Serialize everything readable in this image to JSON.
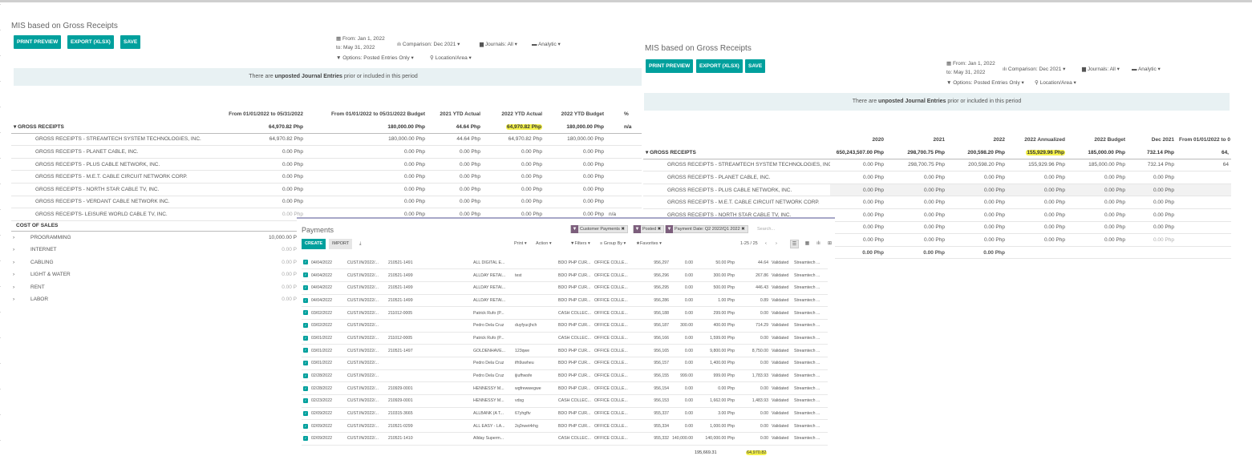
{
  "colors": {
    "accent": "#00a09d",
    "highlight": "#f5f24a",
    "banner": "#e8f1f3",
    "facet": "#7c5e7c"
  },
  "left_report": {
    "title": "MIS based on Gross Receipts",
    "buttons": {
      "print_preview": "PRINT PREVIEW",
      "export": "EXPORT (XLSX)",
      "save": "SAVE"
    },
    "filters": {
      "from": "From: Jan 1, 2022",
      "to": "to: May 31, 2022",
      "comparison": "Comparison: Dec 2021",
      "journals": "Journals: All",
      "analytic": "Analytic",
      "options": "Options: Posted Entries Only",
      "location": "Location/Area"
    },
    "banner": {
      "prefix": "There are ",
      "bold": "unposted Journal Entries",
      "suffix": " prior or included in this period"
    },
    "columns": [
      "From 01/01/2022 to 05/31/2022",
      "From 01/01/2022 to 05/31/2022 Budget",
      "2021 YTD Actual",
      "2022 YTD Actual",
      "2022 YTD Budget",
      "%"
    ],
    "group": {
      "label": "GROSS RECEIPTS",
      "values": [
        "64,970.82 Php",
        "180,000.00 Php",
        "44.64 Php",
        "64,970.82 Php",
        "180,000.00 Php",
        "n/a"
      ]
    },
    "rows": [
      {
        "label": "GROSS RECEIPTS - STREAMTECH SYSTEM TECHNOLOGIES, INC.",
        "values": [
          "64,970.82 Php",
          "180,000.00 Php",
          "44.64 Php",
          "64,970.82 Php",
          "180,000.00 Php",
          ""
        ]
      },
      {
        "label": "GROSS RECEIPTS - PLANET CABLE, INC.",
        "values": [
          "0.00 Php",
          "0.00 Php",
          "0.00 Php",
          "0.00 Php",
          "0.00 Php",
          ""
        ]
      },
      {
        "label": "GROSS RECEIPTS - PLUS CABLE NETWORK, INC.",
        "values": [
          "0.00 Php",
          "0.00 Php",
          "0.00 Php",
          "0.00 Php",
          "0.00 Php",
          ""
        ]
      },
      {
        "label": "GROSS RECEIPTS - M.E.T. CABLE CIRCUIT NETWORK CORP.",
        "values": [
          "0.00 Php",
          "0.00 Php",
          "0.00 Php",
          "0.00 Php",
          "0.00 Php",
          ""
        ]
      },
      {
        "label": "GROSS RECEIPTS - NORTH STAR CABLE TV, INC.",
        "values": [
          "0.00 Php",
          "0.00 Php",
          "0.00 Php",
          "0.00 Php",
          "0.00 Php",
          ""
        ]
      },
      {
        "label": "GROSS RECEIPTS - VERDANT CABLE NETWORK INC.",
        "values": [
          "0.00 Php",
          "0.00 Php",
          "0.00 Php",
          "0.00 Php",
          "0.00 Php",
          ""
        ]
      },
      {
        "label": "GROSS RECEIPTS- LEISURE WORLD CABLE TV, INC.",
        "values": [
          "0.00 Php",
          "0.00 Php",
          "0.00 Php",
          "0.00 Php",
          "0.00 Php",
          "n/a"
        ]
      }
    ],
    "cost_of_sales": {
      "label": "COST OF SALES",
      "items": [
        {
          "label": "PROGRAMMING",
          "value": "10,000.00 P"
        },
        {
          "label": "INTERNET",
          "value": "0.00 P"
        },
        {
          "label": "CABLING",
          "value": "0.00 P"
        },
        {
          "label": "LIGHT & WATER",
          "value": "0.00 P"
        },
        {
          "label": "RENT",
          "value": "0.00 P"
        },
        {
          "label": "LABOR",
          "value": "0.00 P"
        }
      ]
    }
  },
  "right_report": {
    "title": "MIS based on Gross Receipts",
    "buttons": {
      "print_preview": "PRINT PREVIEW",
      "export": "EXPORT (XLSX)",
      "save": "SAVE"
    },
    "filters": {
      "from": "From: Jan 1, 2022",
      "to": "to: May 31, 2022",
      "comparison": "Comparison: Dec 2021",
      "journals": "Journals: All",
      "analytic": "Analytic",
      "options": "Options: Posted Entries Only",
      "location": "Location/Area"
    },
    "banner": {
      "prefix": "There are ",
      "bold": "unposted Journal Entries",
      "suffix": " prior or included in this period"
    },
    "columns": [
      "2020",
      "2021",
      "2022",
      "2022 Annualized",
      "2022 Budget",
      "Dec 2021",
      "From 01/01/2022 to 0"
    ],
    "group": {
      "label": "GROSS RECEIPTS",
      "values": [
        "650,243,507.00 Php",
        "298,700.75 Php",
        "200,598.20 Php",
        "155,929.96 Php",
        "185,000.00 Php",
        "732.14 Php",
        "64,"
      ]
    },
    "rows": [
      {
        "label": "GROSS RECEIPTS - STREAMTECH SYSTEM TECHNOLOGIES, INC.",
        "values": [
          "0.00 Php",
          "298,700.75 Php",
          "200,598.20 Php",
          "155,929.96 Php",
          "185,000.00 Php",
          "732.14 Php",
          "64"
        ]
      },
      {
        "label": "GROSS RECEIPTS - PLANET CABLE, INC.",
        "values": [
          "0.00 Php",
          "0.00 Php",
          "0.00 Php",
          "0.00 Php",
          "0.00 Php",
          "0.00 Php",
          ""
        ]
      },
      {
        "label": "GROSS RECEIPTS - PLUS CABLE NETWORK, INC.",
        "values": [
          "0.00 Php",
          "0.00 Php",
          "0.00 Php",
          "0.00 Php",
          "0.00 Php",
          "0.00 Php",
          ""
        ]
      },
      {
        "label": "GROSS RECEIPTS - M.E.T. CABLE CIRCUIT NETWORK CORP.",
        "values": [
          "0.00 Php",
          "0.00 Php",
          "0.00 Php",
          "0.00 Php",
          "0.00 Php",
          "0.00 Php",
          ""
        ]
      },
      {
        "label": "GROSS RECEIPTS - NORTH STAR CABLE TV, INC.",
        "values": [
          "0.00 Php",
          "0.00 Php",
          "0.00 Php",
          "0.00 Php",
          "0.00 Php",
          "0.00 Php",
          ""
        ]
      },
      {
        "label": "",
        "values": [
          "0.00 Php",
          "0.00 Php",
          "0.00 Php",
          "0.00 Php",
          "0.00 Php",
          "0.00 Php",
          ""
        ]
      },
      {
        "label": "",
        "values": [
          "0.00 Php",
          "0.00 Php",
          "0.00 Php",
          "0.00 Php",
          "0.00 Php",
          "0.00 Php",
          ""
        ]
      },
      {
        "label": "",
        "values": [
          "0.00 Php",
          "0.00 Php",
          "0.00 Php",
          "",
          "",
          "",
          ""
        ]
      }
    ]
  },
  "payments": {
    "title": "Payments",
    "facets": [
      "Customer Payments",
      "Posted",
      "Payment Date: Q2 2022/Q1 2022"
    ],
    "search_placeholder": "Search...",
    "create": "CREATE",
    "import": "IMPORT",
    "print": "Print",
    "action": "Action",
    "filters": "Filters",
    "group_by": "Group By",
    "favorites": "Favorites",
    "pager": "1-25 / 25",
    "rows": [
      [
        "04/04/2022",
        "CUST.IN/2022/...",
        "210521-1491",
        "ALL DIGITAL E...",
        "",
        "BDO PHP CUR...",
        "OFFICE COLLE...",
        "956,297",
        "0.00",
        "50.00 Php",
        "44.64",
        "Validated",
        "Streamtech ..."
      ],
      [
        "04/04/2022",
        "CUST.IN/2022/...",
        "210521-1499",
        "ALLDAY RETAI...",
        "test",
        "BDO PHP CUR...",
        "OFFICE COLLE...",
        "956,296",
        "0.00",
        "300.00 Php",
        "267.86",
        "Validated",
        "Streamtech ..."
      ],
      [
        "04/04/2022",
        "CUST.IN/2022/...",
        "210521-1499",
        "ALLDAY RETAI...",
        "",
        "BDO PHP CUR...",
        "OFFICE COLLE...",
        "956,295",
        "0.00",
        "500.00 Php",
        "446.43",
        "Validated",
        "Streamtech ..."
      ],
      [
        "04/04/2022",
        "CUST.IN/2022/...",
        "210521-1499",
        "ALLDAY RETAI...",
        "",
        "BDO PHP CUR...",
        "OFFICE COLLE...",
        "956,286",
        "0.00",
        "1.00 Php",
        "0.89",
        "Validated",
        "Streamtech ..."
      ],
      [
        "03/02/2022",
        "CUST.IN/2022/...",
        "211012-0005",
        "Patrick Rufo (P...",
        "",
        "CASH COLLEC...",
        "OFFICE COLLE...",
        "956,188",
        "0.00",
        "299.00 Php",
        "0.00",
        "Validated",
        "Streamtech ..."
      ],
      [
        "03/02/2022",
        "CUST.IN/2022/...",
        "",
        "Pedro Dela Cruz",
        "duyfyucjhch",
        "BDO PHP CUR...",
        "OFFICE COLLE...",
        "956,187",
        "300.00",
        "400.00 Php",
        "714.29",
        "Validated",
        "Streamtech ..."
      ],
      [
        "03/01/2022",
        "CUST.IN/2022/...",
        "211012-0005",
        "Patrick Rufo (P...",
        "",
        "CASH COLLEC...",
        "OFFICE COLLE...",
        "956,166",
        "0.00",
        "1,599.00 Php",
        "0.00",
        "Validated",
        "Streamtech ..."
      ],
      [
        "03/01/2022",
        "CUST.IN/2022/...",
        "210521-1497",
        "GOLDENHAVE...",
        "123qwe",
        "BDO PHP CUR...",
        "OFFICE COLLE...",
        "956,165",
        "0.00",
        "9,800.00 Php",
        "8,750.00",
        "Validated",
        "Streamtech ..."
      ],
      [
        "03/01/2022",
        "CUST.IN/2022/...",
        "",
        "Pedro Dela Cruz",
        "ifh9uwheu",
        "BDO PHP CUR...",
        "OFFICE COLLE...",
        "956,157",
        "0.00",
        "1,400.00 Php",
        "0.00",
        "Validated",
        "Streamtech ..."
      ],
      [
        "02/28/2022",
        "CUST.IN/2022/...",
        "",
        "Pedro Dela Cruz",
        "ijiufhwsfe",
        "BDO PHP CUR...",
        "OFFICE COLLE...",
        "956,155",
        "999.00",
        "999.00 Php",
        "1,783.93",
        "Validated",
        "Streamtech ..."
      ],
      [
        "02/28/2022",
        "CUST.IN/2022/...",
        "210929-0001",
        "HENNESSY M...",
        "wgfrewwegwe",
        "BDO PHP CUR...",
        "OFFICE COLLE...",
        "956,154",
        "0.00",
        "0.00 Php",
        "0.00",
        "Validated",
        "Streamtech ..."
      ],
      [
        "02/23/2022",
        "CUST.IN/2022/...",
        "210929-0001",
        "HENNESSY M...",
        "vdsg",
        "CASH COLLEC...",
        "OFFICE COLLE...",
        "956,153",
        "0.00",
        "1,662.00 Php",
        "1,483.93",
        "Validated",
        "Streamtech ..."
      ],
      [
        "02/09/2022",
        "CUST.IN/2022/...",
        "210315-3665",
        "ALLBANK (A T...",
        "67yhgftv",
        "BDO PHP CUR...",
        "OFFICE COLLE...",
        "955,337",
        "0.00",
        "3.00 Php",
        "0.00",
        "Validated",
        "Streamtech ..."
      ],
      [
        "02/09/2022",
        "CUST.IN/2022/...",
        "210521-0299",
        "ALL EASY - LA...",
        "2q3rwet4rhg",
        "BDO PHP CUR...",
        "OFFICE COLLE...",
        "955,334",
        "0.00",
        "1,000.00 Php",
        "0.00",
        "Validated",
        "Streamtech ..."
      ],
      [
        "02/09/2022",
        "CUST.IN/2022/...",
        "210521-1410",
        "Allday Superm...",
        "",
        "CASH COLLEC...",
        "OFFICE COLLE...",
        "955,332",
        "140,000.00",
        "140,000.00 Php",
        "0.00",
        "Validated",
        "Streamtech ..."
      ]
    ],
    "totals": {
      "amount": "195,669.31",
      "company_amount": "64,970.82"
    }
  }
}
